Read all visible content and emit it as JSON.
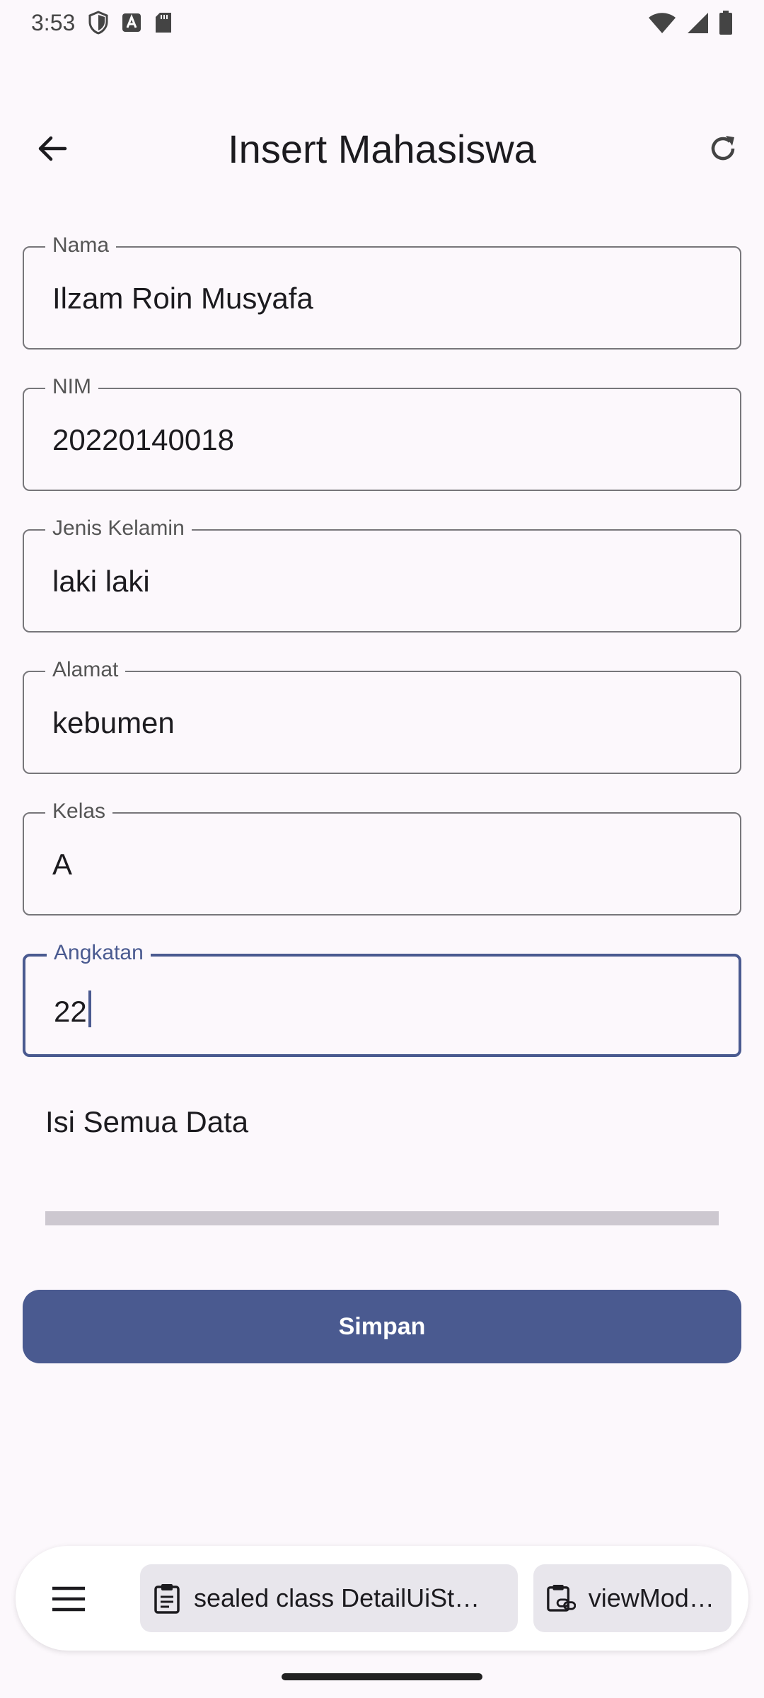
{
  "status_bar": {
    "time": "3:53"
  },
  "app_bar": {
    "title": "Insert Mahasiswa"
  },
  "form": {
    "fields": [
      {
        "label": "Nama",
        "value": "Ilzam Roin Musyafa"
      },
      {
        "label": "NIM",
        "value": "20220140018"
      },
      {
        "label": "Jenis Kelamin",
        "value": "laki laki"
      },
      {
        "label": "Alamat",
        "value": "kebumen"
      },
      {
        "label": "Kelas",
        "value": "A"
      },
      {
        "label": "Angkatan",
        "value": "22"
      }
    ],
    "hint": "Isi Semua Data",
    "save_label": "Simpan"
  },
  "bottom_bar": {
    "chips": [
      {
        "label": "sealed class DetailUiSt…",
        "icon": "clipboard-icon"
      },
      {
        "label": "viewModelS",
        "icon": "link-clipboard-icon"
      }
    ]
  },
  "colors": {
    "accent": "#4a5a90",
    "background": "#fcf8fc",
    "outline": "#77767a"
  }
}
